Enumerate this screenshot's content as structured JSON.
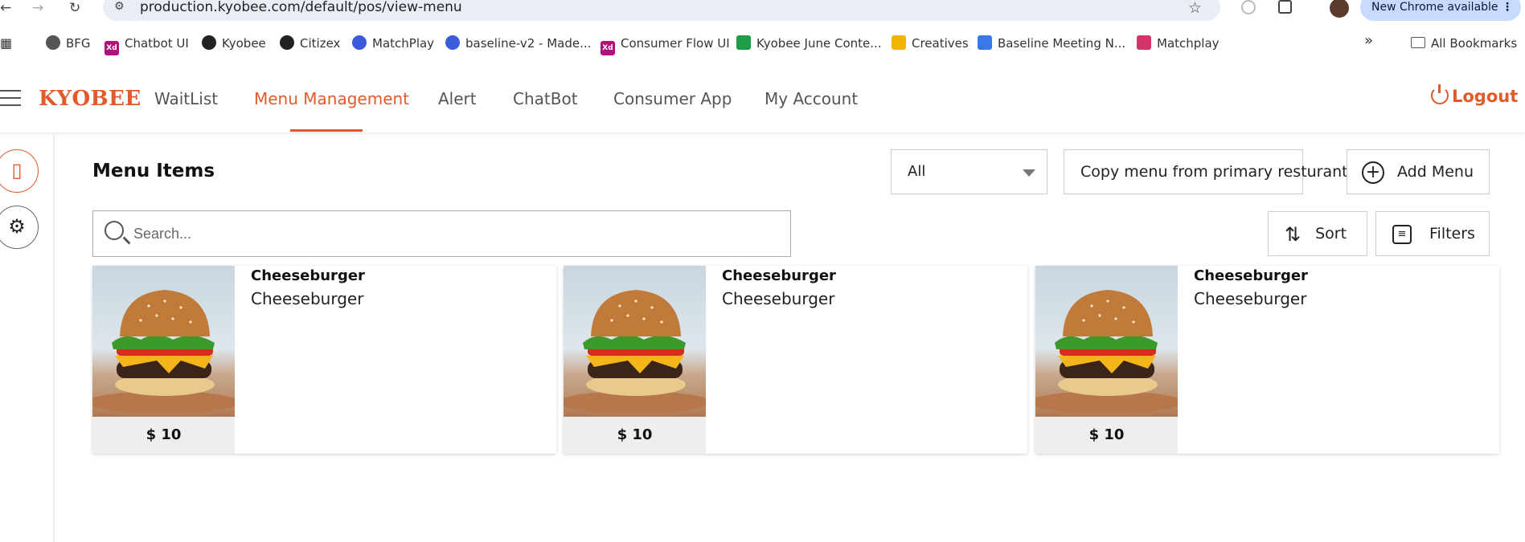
{
  "browser": {
    "url": "production.kyobee.com/default/pos/view-menu",
    "update_label": "New Chrome available",
    "bookmarks": [
      {
        "label": "BFG",
        "color": "#555555",
        "icon": "bfg-icon"
      },
      {
        "label": "Chatbot UI",
        "color": "#b0127a",
        "icon": "xd-icon"
      },
      {
        "label": "Kyobee",
        "color": "#222222",
        "icon": "github-icon"
      },
      {
        "label": "Citizex",
        "color": "#222222",
        "icon": "github-icon"
      },
      {
        "label": "MatchPlay",
        "color": "#3b5bdb",
        "icon": "matchplay-icon"
      },
      {
        "label": "baseline-v2 - Made...",
        "color": "#3b5bdb",
        "icon": "matchplay-icon"
      },
      {
        "label": "Consumer Flow UI",
        "color": "#b0127a",
        "icon": "xd-icon"
      },
      {
        "label": "Kyobee June Conte...",
        "color": "#1e9e48",
        "icon": "sheets-icon"
      },
      {
        "label": "Creatives",
        "color": "#f2b300",
        "icon": "drive-icon"
      },
      {
        "label": "Baseline Meeting N...",
        "color": "#3b78e7",
        "icon": "docs-icon"
      },
      {
        "label": "Matchplay",
        "color": "#d6336c",
        "icon": "matchplay-logo-icon"
      }
    ],
    "overflow": "»",
    "all_bookmarks": "All Bookmarks"
  },
  "app": {
    "logo": "KYOBEE",
    "nav": [
      "WaitList",
      "Menu Management",
      "Alert",
      "ChatBot",
      "Consumer App",
      "My Account"
    ],
    "active_nav": "Menu Management",
    "logout": "Logout",
    "accent_color": "#e05a2b"
  },
  "main": {
    "title": "Menu Items",
    "filter_select": "All",
    "copy_button": "Copy menu from primary resturant",
    "add_button": "Add Menu",
    "search_placeholder": "Search...",
    "sort_button": "Sort",
    "filters_button": "Filters",
    "items": [
      {
        "name": "Cheeseburger",
        "description": "Cheeseburger",
        "price": "$ 10"
      },
      {
        "name": "Cheeseburger",
        "description": "Cheeseburger",
        "price": "$ 10"
      },
      {
        "name": "Cheeseburger",
        "description": "Cheeseburger",
        "price": "$ 10"
      }
    ]
  }
}
